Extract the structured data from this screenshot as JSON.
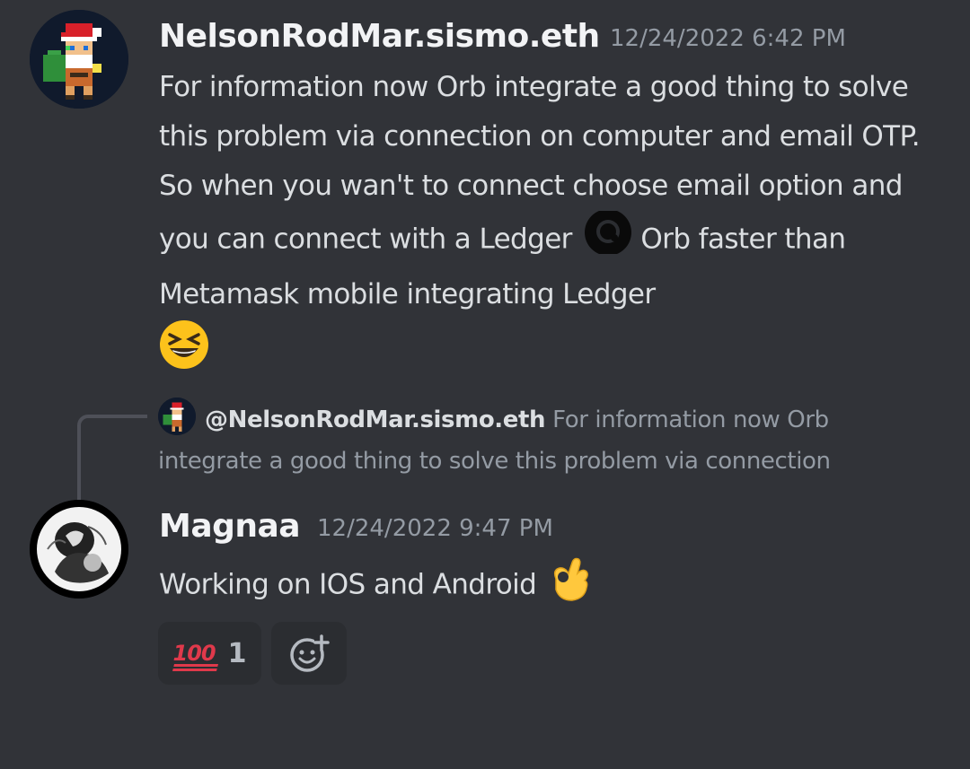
{
  "messages": [
    {
      "author": "NelsonRodMar.sismo.eth",
      "timestamp": "12/24/2022 6:42 PM",
      "text_part_1": "For information now Orb integrate a good thing to solve this problem via connection on computer and email OTP. So when you wan't to connect choose email option and you can connect with a Ledger",
      "text_part_2": "Orb faster than Metamask mobile integrating Ledger",
      "inline_icons": [
        "orb-logo-icon",
        "laughing-emoji-icon"
      ]
    },
    {
      "author": "Magnaa",
      "timestamp": "12/24/2022 9:47 PM",
      "text": "Working on IOS and Android",
      "inline_icons": [
        "ok-hand-emoji-icon"
      ],
      "reply": {
        "mention": "@NelsonRodMar.sismo.eth",
        "preview": "For information now Orb integrate a good thing to solve this problem via connection"
      },
      "reactions": [
        {
          "emoji": "hundred-points-icon",
          "count": "1"
        }
      ],
      "add_reaction_icon": "add-reaction-icon"
    }
  ],
  "colors": {
    "background": "#313338",
    "reaction_bg": "#2b2d31",
    "username": "#f2f3f5",
    "timestamp": "#949ba4",
    "text": "#dbdee1",
    "reply_line": "#4e5058"
  }
}
